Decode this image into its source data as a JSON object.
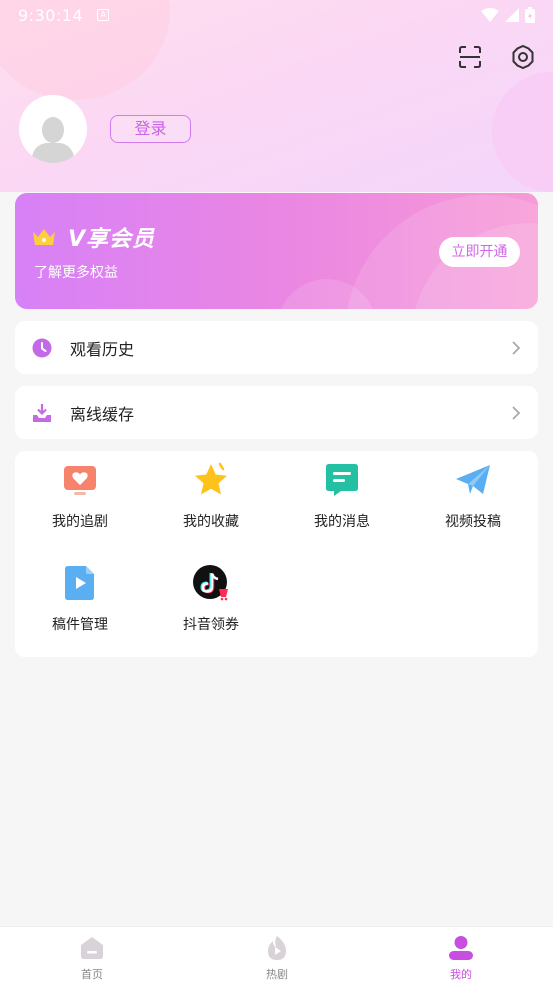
{
  "status_bar": {
    "time": "9:30:14",
    "notification_glyph": "A"
  },
  "header": {
    "login_label": "登录"
  },
  "vip": {
    "title": "V享会员",
    "subtitle": "了解更多权益",
    "open_label": "立即开通"
  },
  "rows": [
    {
      "label": "观看历史",
      "icon": "clock-icon"
    },
    {
      "label": "离线缓存",
      "icon": "download-icon"
    }
  ],
  "grid": [
    {
      "label": "我的追剧",
      "icon": "tv-heart-icon"
    },
    {
      "label": "我的收藏",
      "icon": "star-icon"
    },
    {
      "label": "我的消息",
      "icon": "message-icon"
    },
    {
      "label": "视频投稿",
      "icon": "paper-plane-icon"
    },
    {
      "label": "稿件管理",
      "icon": "video-file-icon"
    },
    {
      "label": "抖音领券",
      "icon": "douyin-icon"
    }
  ],
  "bottom_nav": [
    {
      "label": "首页",
      "icon": "home-icon"
    },
    {
      "label": "热剧",
      "icon": "flame-icon"
    },
    {
      "label": "我的",
      "icon": "person-icon",
      "active": true
    }
  ],
  "colors": {
    "accent": "#c963ea",
    "vip_gradient_start": "#d781f7",
    "vip_gradient_end": "#f79ad7",
    "nav_active": "#c84ee2"
  }
}
